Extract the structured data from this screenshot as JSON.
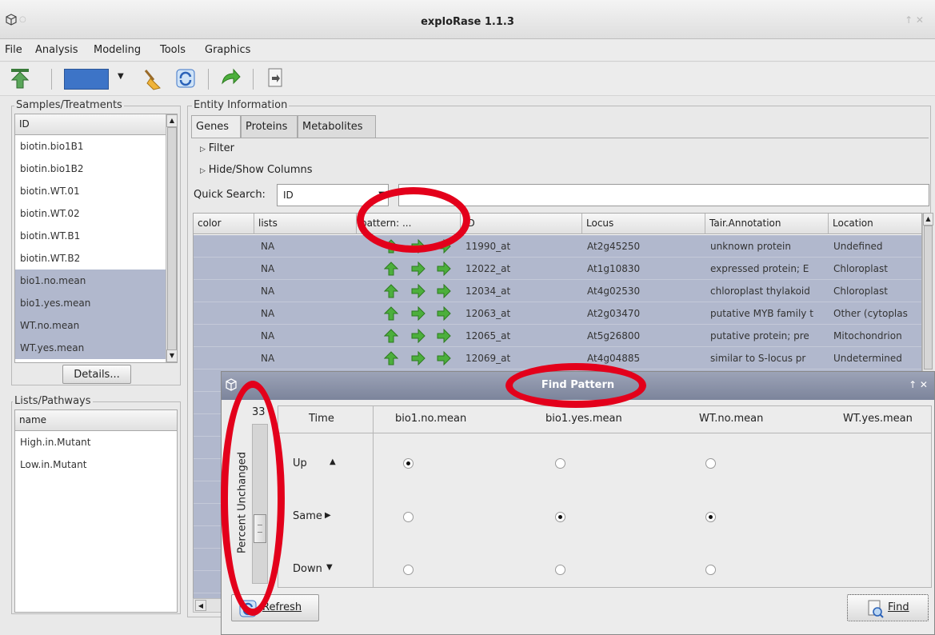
{
  "window": {
    "title": "exploRase 1.1.3"
  },
  "menu": [
    "File",
    "Analysis",
    "Modeling",
    "Tools",
    "Graphics"
  ],
  "samples": {
    "section_label": "Samples/Treatments",
    "header": "ID",
    "items": [
      {
        "label": "biotin.bio1B1",
        "selected": false
      },
      {
        "label": "biotin.bio1B2",
        "selected": false
      },
      {
        "label": "biotin.WT.01",
        "selected": false
      },
      {
        "label": "biotin.WT.02",
        "selected": false
      },
      {
        "label": "biotin.WT.B1",
        "selected": false
      },
      {
        "label": "biotin.WT.B2",
        "selected": false
      },
      {
        "label": "bio1.no.mean",
        "selected": true
      },
      {
        "label": "bio1.yes.mean",
        "selected": true
      },
      {
        "label": "WT.no.mean",
        "selected": true
      },
      {
        "label": "WT.yes.mean",
        "selected": true
      }
    ],
    "details_button": "Details..."
  },
  "lists": {
    "section_label": "Lists/Pathways",
    "header": "name",
    "items": [
      "High.in.Mutant",
      "Low.in.Mutant"
    ]
  },
  "entity": {
    "section_label": "Entity Information",
    "tabs": [
      "Genes",
      "Proteins",
      "Metabolites"
    ],
    "active_tab": "Genes",
    "filter_label": "Filter",
    "hideshow_label": "Hide/Show Columns",
    "quick_search_label": "Quick Search:",
    "quick_search_field": "ID",
    "quick_search_value": "",
    "columns": [
      "color",
      "lists",
      "pattern: ...",
      "ID",
      "Locus",
      "Tair.Annotation",
      "Location"
    ],
    "rows": [
      {
        "lists": "NA",
        "id": "11990_at",
        "locus": "At2g45250",
        "annotation": "unknown protein",
        "location": "Undefined"
      },
      {
        "lists": "NA",
        "id": "12022_at",
        "locus": "At1g10830",
        "annotation": "expressed protein; E",
        "location": "Chloroplast"
      },
      {
        "lists": "NA",
        "id": "12034_at",
        "locus": "At4g02530",
        "annotation": "chloroplast thylakoid",
        "location": "Chloroplast"
      },
      {
        "lists": "NA",
        "id": "12063_at",
        "locus": "At2g03470",
        "annotation": "putative MYB family t",
        "location": "Other (cytoplas"
      },
      {
        "lists": "NA",
        "id": "12065_at",
        "locus": "At5g26800",
        "annotation": "putative protein; pre",
        "location": "Mitochondrion"
      },
      {
        "lists": "NA",
        "id": "12069_at",
        "locus": "At4g04885",
        "annotation": "similar to S-locus pr",
        "location": "Undetermined"
      }
    ]
  },
  "find_pattern": {
    "title": "Find Pattern",
    "slider_value": "33",
    "slider_label": "Percent Unchanged",
    "time_header": "Time",
    "conditions": [
      "bio1.no.mean",
      "bio1.yes.mean",
      "WT.no.mean",
      "WT.yes.mean"
    ],
    "rows": [
      {
        "label": "Up",
        "arrow": "▲"
      },
      {
        "label": "Same",
        "arrow": "▶"
      },
      {
        "label": "Down",
        "arrow": "▼"
      }
    ],
    "refresh_button": "Refresh",
    "find_button": "Find"
  },
  "colors": {
    "selection": "#b1b8cd",
    "highlight_annotation": "#e3001b",
    "arrow_green": "#4caf3c"
  }
}
